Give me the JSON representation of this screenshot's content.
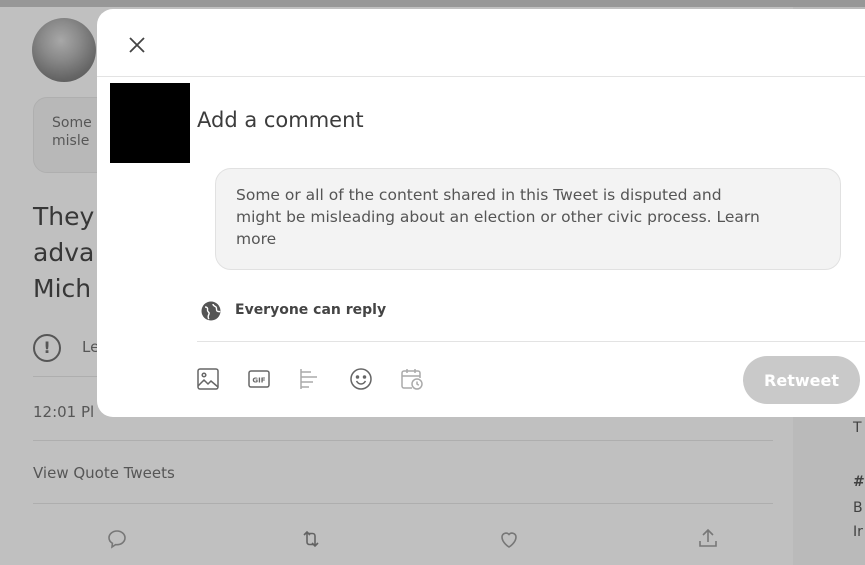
{
  "background": {
    "notice_lines": [
      "Some",
      "misle"
    ],
    "tweet_lines": [
      "They",
      "adva",
      "Mich"
    ],
    "warning_label": "Le",
    "timestamp": "12:01 Pl",
    "view_quotes": "View Quote Tweets",
    "right_col": {
      "line1": "T",
      "line2": "#",
      "line3": "B",
      "line4": "Ir"
    }
  },
  "modal": {
    "compose_placeholder": "Add a comment",
    "quote_lines": [
      "Some or all of the content shared in this Tweet is disputed and",
      "might be misleading about an election or other civic process. Learn",
      "more"
    ],
    "reply_setting": "Everyone can reply",
    "retweet_label": "Retweet",
    "toolbar_icons": [
      "image-icon",
      "gif-icon",
      "poll-icon",
      "emoji-icon",
      "schedule-icon"
    ]
  }
}
